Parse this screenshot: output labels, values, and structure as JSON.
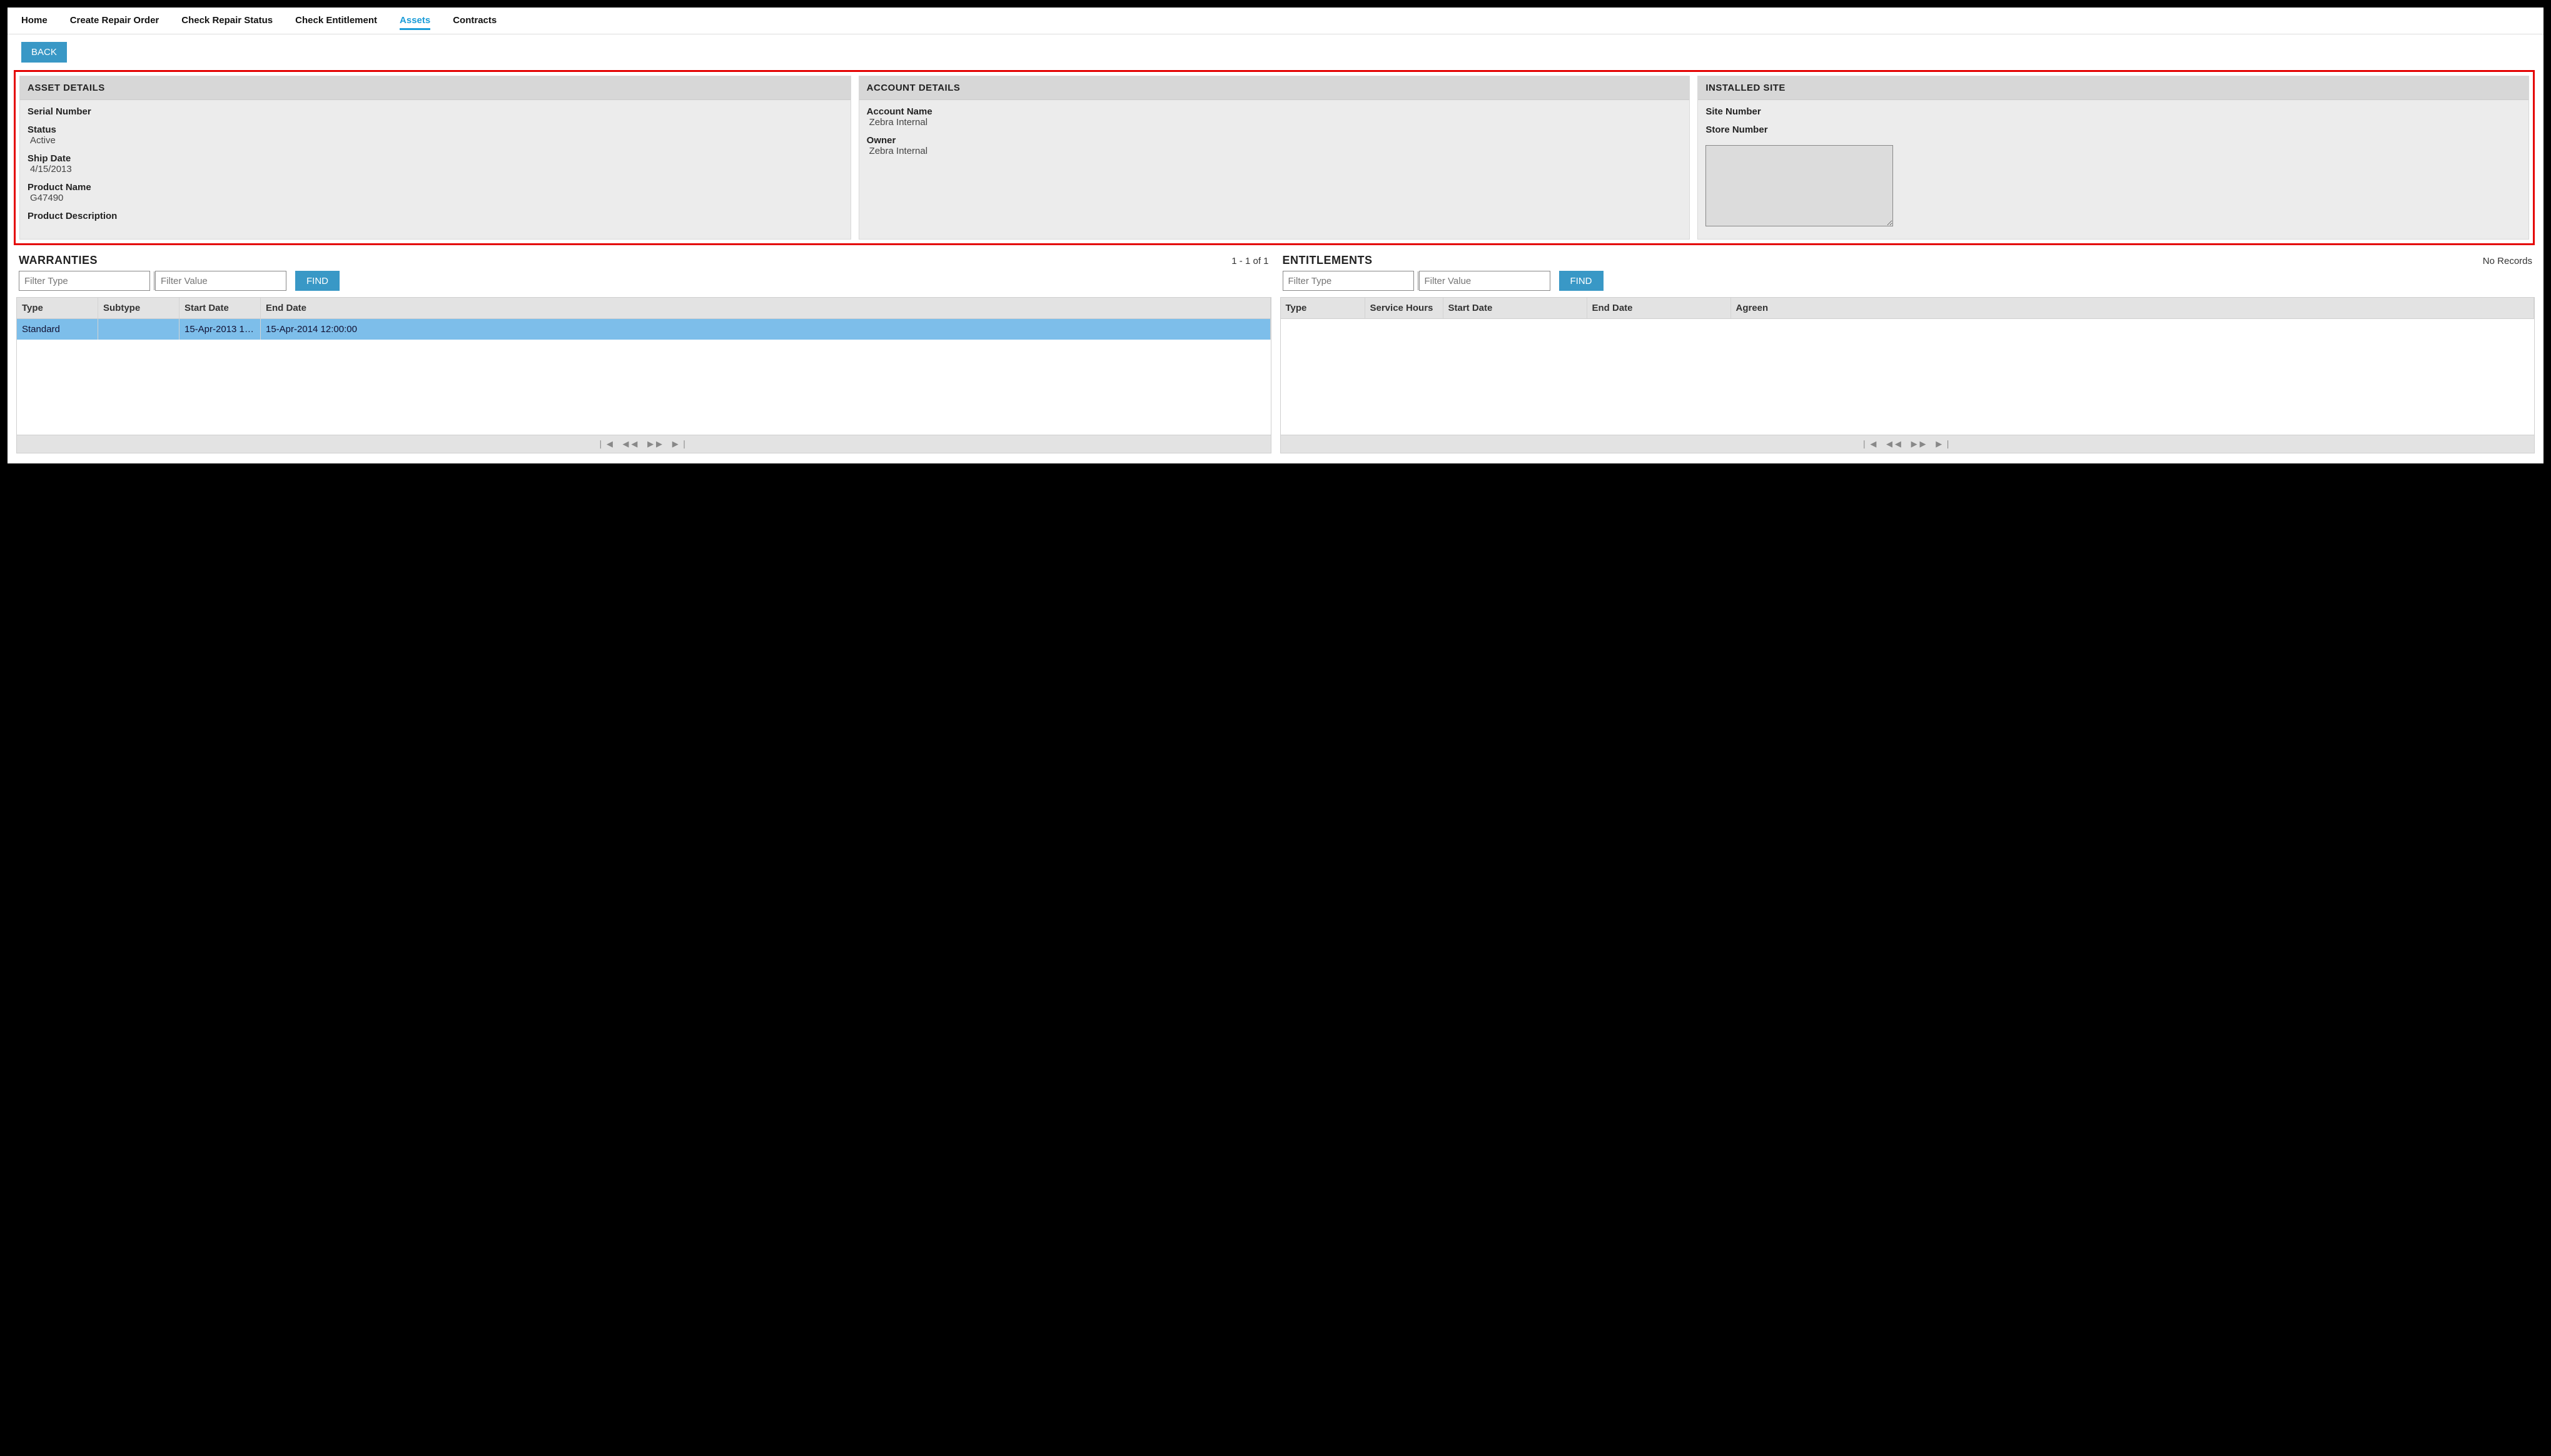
{
  "nav": {
    "items": [
      {
        "label": "Home",
        "active": false
      },
      {
        "label": "Create Repair Order",
        "active": false
      },
      {
        "label": "Check Repair Status",
        "active": false
      },
      {
        "label": "Check Entitlement",
        "active": false
      },
      {
        "label": "Assets",
        "active": true
      },
      {
        "label": "Contracts",
        "active": false
      }
    ]
  },
  "back_label": "BACK",
  "panels": {
    "asset": {
      "title": "ASSET DETAILS",
      "serial_label": "Serial Number",
      "serial_value": "",
      "status_label": "Status",
      "status_value": "Active",
      "ship_label": "Ship Date",
      "ship_value": "4/15/2013",
      "product_label": "Product Name",
      "product_value": "G47490",
      "desc_label": "Product Description",
      "desc_value": ""
    },
    "account": {
      "title": "ACCOUNT DETAILS",
      "name_label": "Account Name",
      "name_value": "Zebra Internal",
      "owner_label": "Owner",
      "owner_value": "Zebra Internal"
    },
    "site": {
      "title": "INSTALLED SITE",
      "site_label": "Site Number",
      "store_label": "Store Number",
      "textarea_value": ""
    }
  },
  "warranties": {
    "title": "WARRANTIES",
    "count": "1 - 1 of 1",
    "filter_type_placeholder": "Filter Type",
    "filter_value_placeholder": "Filter Value",
    "find_label": "FIND",
    "columns": {
      "type": "Type",
      "subtype": "Subtype",
      "start": "Start Date",
      "end": "End Date"
    },
    "rows": [
      {
        "type": "Standard",
        "subtype": "",
        "start": "15-Apr-2013 12:0...",
        "end": "15-Apr-2014 12:00:00"
      }
    ]
  },
  "entitlements": {
    "title": "ENTITLEMENTS",
    "count": "No Records",
    "filter_type_placeholder": "Filter Type",
    "filter_value_placeholder": "Filter Value",
    "find_label": "FIND",
    "columns": {
      "type": "Type",
      "svc": "Service Hours",
      "start": "Start Date",
      "end": "End Date",
      "agree": "Agreen"
    }
  },
  "pager": {
    "first": "❘◀",
    "prev": "◀◀",
    "next": "▶▶",
    "last": "▶❘"
  }
}
